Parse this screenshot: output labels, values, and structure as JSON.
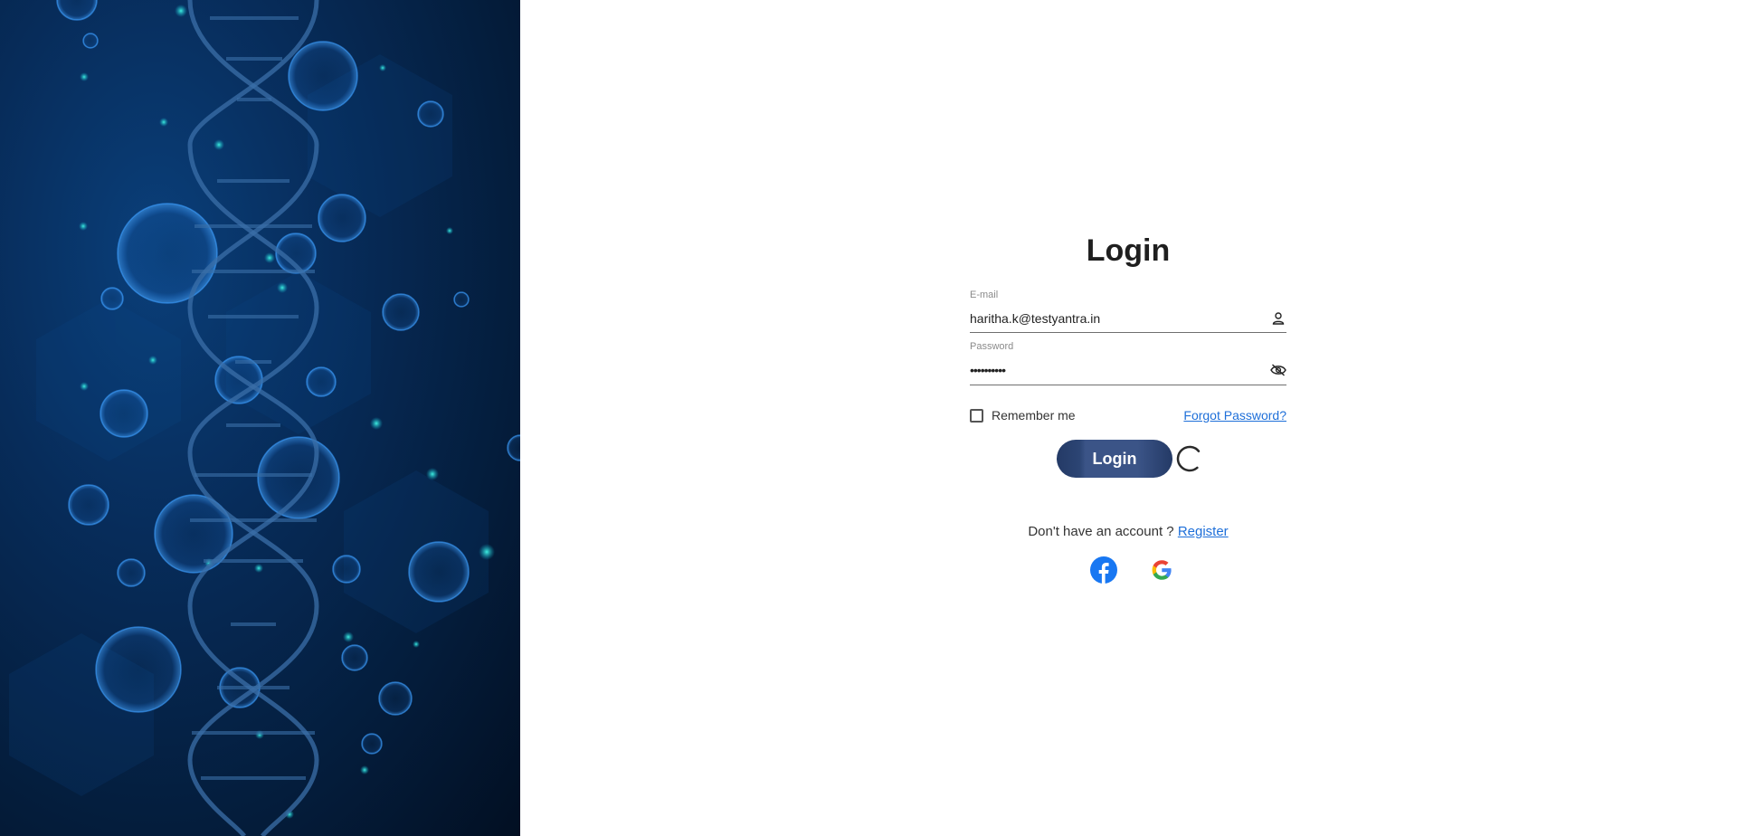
{
  "login": {
    "title": "Login",
    "email": {
      "label": "E-mail",
      "value": "haritha.k@testyantra.in"
    },
    "password": {
      "label": "Password",
      "value": "••••••••••"
    },
    "remember_label": "Remember me",
    "forgot_label": "Forgot Password?",
    "submit_label": "Login",
    "register_prompt": "Don't have an account ?",
    "register_label": "Register"
  },
  "icons": {
    "email": "user-icon",
    "password": "eye-off-icon",
    "social": [
      "facebook-icon",
      "google-icon"
    ]
  },
  "colors": {
    "accent": "#1e6fd9",
    "button": "#2c4574",
    "panel": "#072c5a",
    "facebook": "#1877f2"
  }
}
